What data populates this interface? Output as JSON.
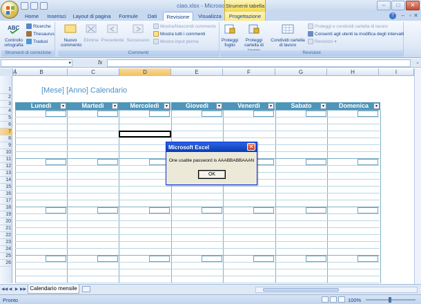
{
  "window": {
    "title": "ciao.xlsx - Microsoft Excel",
    "contextual_tab_label": "Strumenti tabella"
  },
  "tabs": [
    "Home",
    "Inserisci",
    "Layout di pagina",
    "Formule",
    "Dati",
    "Revisione",
    "Visualizza",
    "Progettazione"
  ],
  "active_tab": "Revisione",
  "ribbon": {
    "proofing": {
      "spell_label": "Controllo ortografia",
      "research": "Ricerche",
      "thesaurus": "Thesaurus",
      "translate": "Traduci",
      "group_label": "Strumenti di correzione"
    },
    "comments": {
      "new_comment": "Nuovo commento",
      "delete": "Elimina",
      "previous": "Precedente",
      "next": "Successivo",
      "show_hide": "Mostra/Nascondi commento",
      "show_all": "Mostra tutti i commenti",
      "show_ink": "Mostra input penna",
      "group_label": "Commenti"
    },
    "changes": {
      "protect_sheet": "Proteggi foglio",
      "protect_workbook": "Proteggi cartella di lavoro",
      "share_workbook": "Condividi cartella di lavoro",
      "protect_share": "Proteggi e condividi cartella di lavoro",
      "allow_users": "Consenti agli utenti la modifica degli intervalli",
      "track_changes": "Revisioni",
      "group_label": "Revisioni"
    }
  },
  "formula_bar": {
    "fx": "fx",
    "name_box": "",
    "formula": ""
  },
  "columns": [
    "A",
    "B",
    "C",
    "D",
    "E",
    "F",
    "G",
    "H",
    "I"
  ],
  "selected_column": "D",
  "rows": [
    "1",
    "2",
    "3",
    "4",
    "5",
    "6",
    "7",
    "8",
    "9",
    "10",
    "11",
    "12",
    "13",
    "14",
    "15",
    "16",
    "17",
    "18",
    "19",
    "20",
    "21",
    "22",
    "23",
    "24",
    "25",
    "26"
  ],
  "selected_row": "7",
  "sheet": {
    "title": "[Mese] [Anno] Calendario",
    "days": [
      "Lunedì",
      "Martedì",
      "Mercoledì",
      "Giovedì",
      "Venerdì",
      "Sabato",
      "Domenica"
    ],
    "filter_glyph": "▾"
  },
  "dialog": {
    "title": "Microsoft Excel",
    "message": "One usable password is AAABBABBAAAN",
    "ok": "OK",
    "close_glyph": "✕"
  },
  "sheet_tab": "Calendario mensile",
  "status": {
    "ready": "Pronto",
    "zoom": "100%",
    "zoom_minus": "−",
    "zoom_plus": "+"
  },
  "colors": {
    "header_teal": "#4f95b8",
    "title_blue": "#4a90c8",
    "ribbon_blue": "#dfe9f7"
  }
}
